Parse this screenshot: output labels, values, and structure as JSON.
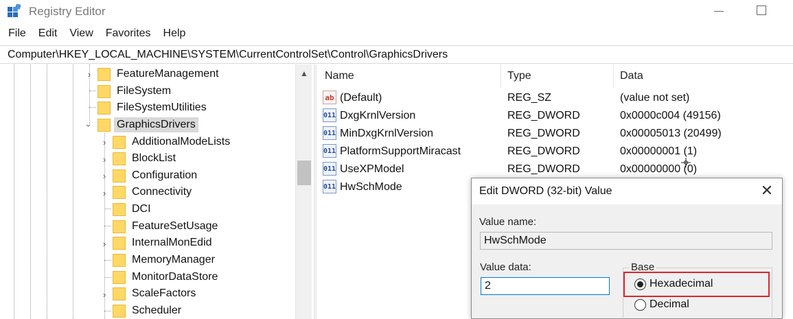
{
  "window": {
    "title": "Registry Editor"
  },
  "menu": [
    "File",
    "Edit",
    "View",
    "Favorites",
    "Help"
  ],
  "address": "Computer\\HKEY_LOCAL_MACHINE\\SYSTEM\\CurrentControlSet\\Control\\GraphicsDrivers",
  "tree": {
    "items": [
      {
        "label": "FeatureManagement",
        "expanded": false,
        "level": 1
      },
      {
        "label": "FileSystem",
        "expanded": null,
        "level": 1
      },
      {
        "label": "FileSystemUtilities",
        "expanded": null,
        "level": 1
      },
      {
        "label": "GraphicsDrivers",
        "expanded": true,
        "level": 1,
        "selected": true
      },
      {
        "label": "AdditionalModeLists",
        "expanded": false,
        "level": 2
      },
      {
        "label": "BlockList",
        "expanded": false,
        "level": 2
      },
      {
        "label": "Configuration",
        "expanded": false,
        "level": 2
      },
      {
        "label": "Connectivity",
        "expanded": false,
        "level": 2
      },
      {
        "label": "DCI",
        "expanded": null,
        "level": 2
      },
      {
        "label": "FeatureSetUsage",
        "expanded": null,
        "level": 2
      },
      {
        "label": "InternalMonEdid",
        "expanded": false,
        "level": 2
      },
      {
        "label": "MemoryManager",
        "expanded": null,
        "level": 2
      },
      {
        "label": "MonitorDataStore",
        "expanded": null,
        "level": 2
      },
      {
        "label": "ScaleFactors",
        "expanded": false,
        "level": 2
      },
      {
        "label": "Scheduler",
        "expanded": null,
        "level": 2
      }
    ]
  },
  "list": {
    "columns": {
      "name": "Name",
      "type": "Type",
      "data": "Data"
    },
    "rows": [
      {
        "name": "(Default)",
        "type": "REG_SZ",
        "data": "(value not set)",
        "icon": "string-value-icon"
      },
      {
        "name": "DxgKrnlVersion",
        "type": "REG_DWORD",
        "data": "0x0000c004 (49156)",
        "icon": "binary-value-icon"
      },
      {
        "name": "MinDxgKrnlVersion",
        "type": "REG_DWORD",
        "data": "0x00005013 (20499)",
        "icon": "binary-value-icon"
      },
      {
        "name": "PlatformSupportMiracast",
        "type": "REG_DWORD",
        "data": "0x00000001 (1)",
        "icon": "binary-value-icon"
      },
      {
        "name": "UseXPModel",
        "type": "REG_DWORD",
        "data": "0x00000000 (0)",
        "icon": "binary-value-icon"
      },
      {
        "name": "HwSchMode",
        "type": "",
        "data": "",
        "icon": "binary-value-icon"
      }
    ]
  },
  "dialog": {
    "title": "Edit DWORD (32-bit) Value",
    "value_name_label": "Value name:",
    "value_name": "HwSchMode",
    "value_data_label": "Value data:",
    "value_data": "2",
    "base_label": "Base",
    "hex_label": "Hexadecimal",
    "dec_label": "Decimal",
    "selected_base": "Hexadecimal"
  },
  "colors": {
    "highlight": "#e0242b",
    "folder": "#ffd866",
    "selection": "#d9d9d9"
  }
}
